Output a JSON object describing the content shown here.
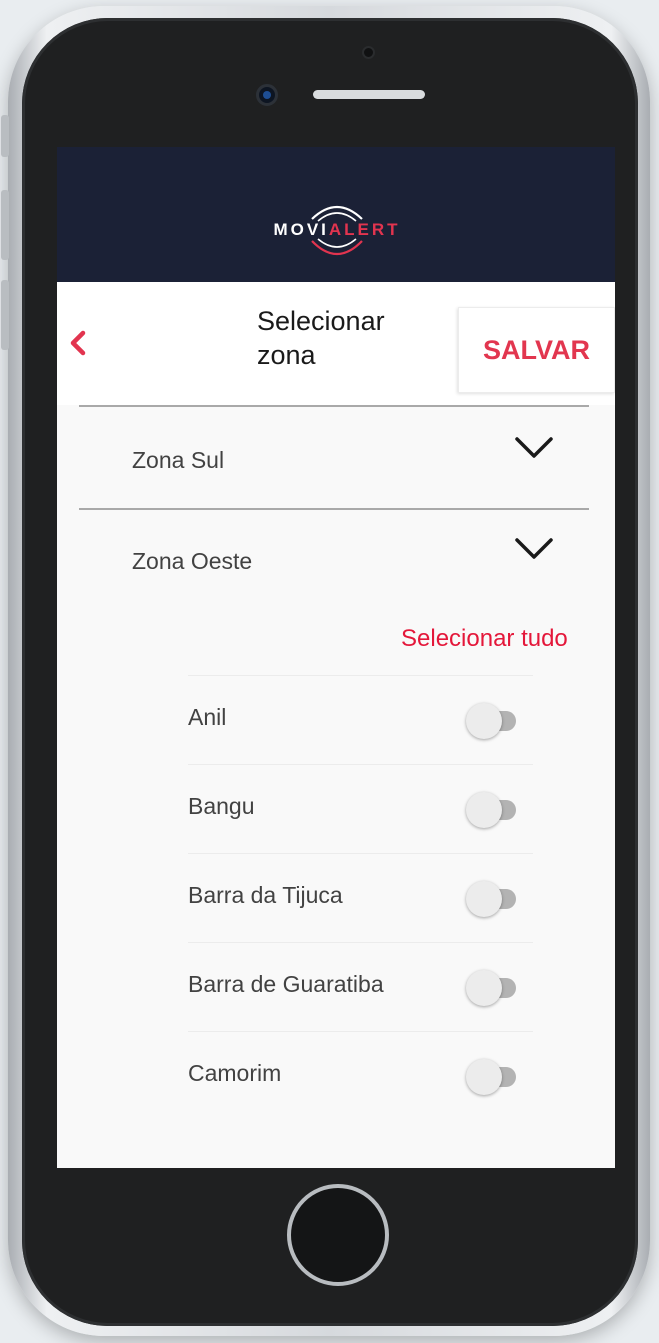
{
  "app": {
    "logo": {
      "movi": "MOVI",
      "alert": "ALERT"
    }
  },
  "header": {
    "title": "Selecionar zona",
    "save_label": "SALVAR"
  },
  "zones": [
    {
      "name": "Zona Sul",
      "expanded": false
    },
    {
      "name": "Zona Oeste",
      "expanded": true
    }
  ],
  "select_all_label": "Selecionar tudo",
  "neighborhoods": [
    {
      "name": "Anil",
      "selected": false
    },
    {
      "name": "Bangu",
      "selected": false
    },
    {
      "name": "Barra da Tijuca",
      "selected": false
    },
    {
      "name": "Barra de Guaratiba",
      "selected": false
    },
    {
      "name": "Camorim",
      "selected": false
    }
  ],
  "colors": {
    "header_bg": "#1b2136",
    "accent": "#e2364f",
    "select_all": "#e4173a",
    "toggle_off_track": "#b3b3b3",
    "toggle_off_knob": "#ececec"
  },
  "icons": {
    "back": "chevron-left-icon",
    "expand": "chevron-down-icon"
  }
}
